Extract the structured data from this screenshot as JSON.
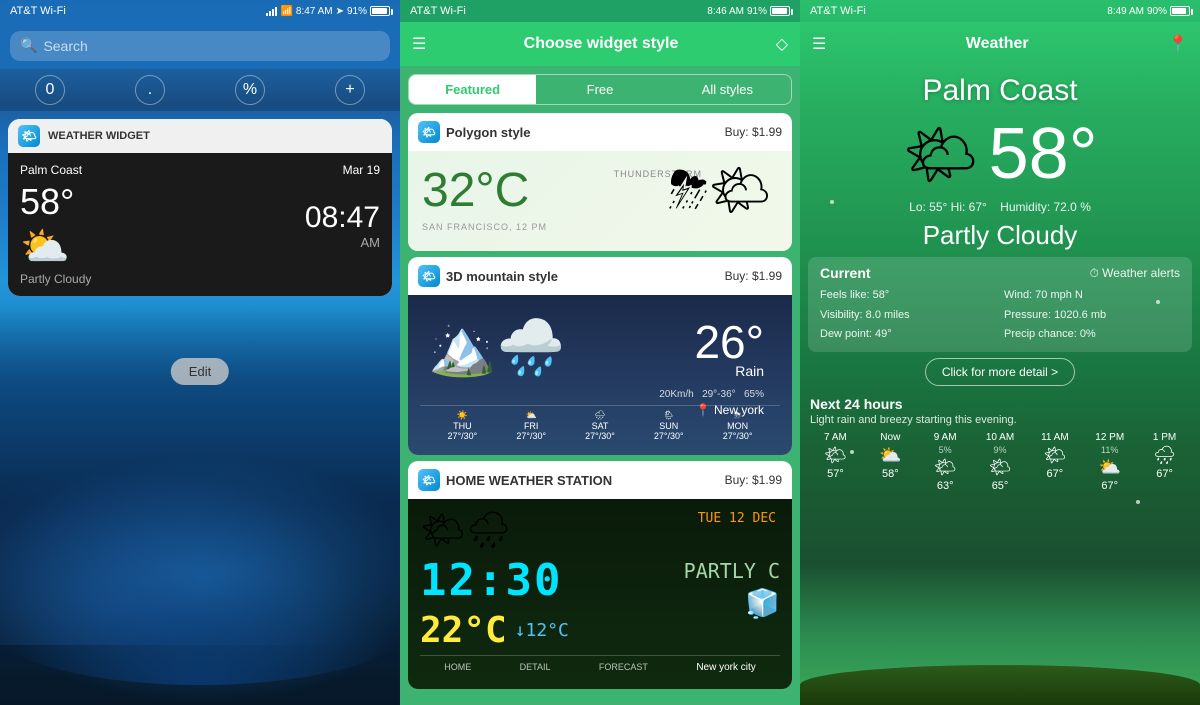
{
  "panel1": {
    "status": {
      "carrier": "AT&T Wi-Fi",
      "time": "8:47 AM",
      "battery": "91%"
    },
    "search_placeholder": "Search",
    "numbers": [
      "0",
      ".",
      "%",
      "+"
    ],
    "widget": {
      "title": "WEATHER WIDGET",
      "location": "Palm Coast",
      "date": "Mar 19",
      "temp": "58°",
      "time_display": "08:47",
      "condition": "Partly Cloudy",
      "am_pm": "AM"
    },
    "edit_label": "Edit"
  },
  "panel2": {
    "status": {
      "carrier": "AT&T Wi-Fi",
      "time": "8:46 AM",
      "battery": "91%"
    },
    "header_title": "Choose widget style",
    "tabs": [
      "Featured",
      "Free",
      "All styles"
    ],
    "active_tab": "Featured",
    "widgets": [
      {
        "title": "Polygon style",
        "price": "Buy: $1.99",
        "preview": {
          "temp": "32°C",
          "weather_label": "THUNDERSTORM",
          "location": "SAN FRANCISCO, 12 PM"
        }
      },
      {
        "title": "3D mountain style",
        "price": "Buy: $1.99",
        "preview": {
          "temp": "26°",
          "condition": "Rain",
          "wind": "20Km/h",
          "temp_range": "29°-36°",
          "humidity": "65%",
          "location": "New york",
          "forecast": [
            {
              "day": "THU",
              "temps": "27°/30°"
            },
            {
              "day": "FRI",
              "temps": "27°/30°"
            },
            {
              "day": "SAT",
              "temps": "27°/30°"
            },
            {
              "day": "SUN",
              "temps": "27°/30°"
            },
            {
              "day": "MON",
              "temps": "27°/30°"
            }
          ]
        }
      },
      {
        "title": "HOME WEATHER STATION",
        "price": "Buy: $1.99",
        "preview": {
          "time": "12:30",
          "temp": "22°C",
          "down_temp": "↓12°C",
          "date_display": "TUE 12 DEC",
          "condition": "PARTLY C",
          "location": "New york city"
        }
      }
    ]
  },
  "panel3": {
    "status": {
      "carrier": "AT&T Wi-Fi",
      "time": "8:49 AM",
      "battery": "90%"
    },
    "header_title": "Weather",
    "city": "Palm Coast",
    "temp": "58°",
    "lo": "55°",
    "hi": "67°",
    "humidity": "72.0 %",
    "condition": "Partly Cloudy",
    "current": {
      "title": "Current",
      "alerts_label": "⏱ Weather alerts",
      "feels_like": "Feels like: 58°",
      "visibility": "Visibility: 8.0 miles",
      "dew_point": "Dew point: 49°",
      "wind": "Wind: 70 mph N",
      "pressure": "Pressure: 1020.6 mb",
      "precip": "Precip chance: 0%"
    },
    "detail_btn": "Click for more detail >",
    "next24": {
      "title": "Next 24 hours",
      "description": "Light rain and breezy starting this evening.",
      "hours": [
        {
          "label": "7 AM",
          "pct": "",
          "icon": "🌤",
          "temp": "57°"
        },
        {
          "label": "Now",
          "pct": "",
          "icon": "⛅",
          "temp": "58°"
        },
        {
          "label": "9 AM",
          "pct": "5%",
          "icon": "🌤",
          "temp": "63°"
        },
        {
          "label": "10 AM",
          "pct": "9%",
          "icon": "🌤",
          "temp": "65°"
        },
        {
          "label": "11 AM",
          "pct": "",
          "icon": "🌤",
          "temp": "67°"
        },
        {
          "label": "12 PM",
          "pct": "11%",
          "icon": "⛅",
          "temp": "67°"
        },
        {
          "label": "1 PM",
          "pct": "",
          "icon": "🌧",
          "temp": "67°"
        }
      ]
    }
  }
}
